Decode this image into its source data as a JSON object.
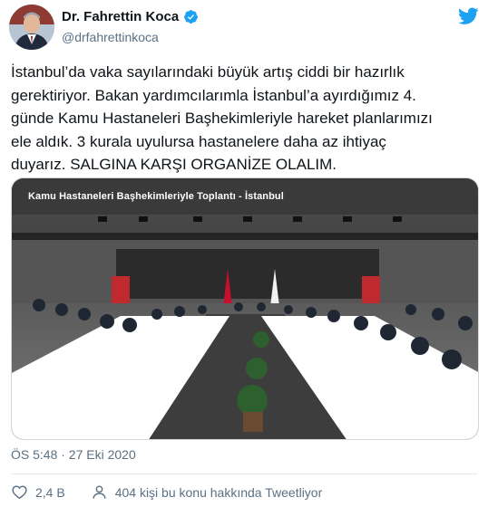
{
  "author": {
    "display_name": "Dr. Fahrettin Koca",
    "handle": "@drfahrettinkoca",
    "verified": true
  },
  "tweet": {
    "text": "İstanbul’da vaka sayılarındaki büyük artış ciddi bir hazırlık\ngerektiriyor. Bakan yardımcılarımla İstanbul’a ayırdığımız 4.\ngünde Kamu Hastaneleri Başhekimleriyle hareket planlarımızı\nele aldık. 3 kurala uyulursa hastanelere daha az ihtiyaç\nduyarız. SALGINA KARŞI ORGANİZE OLALIM.",
    "media_caption": "Kamu Hastaneleri Başhekimleriyle Toplantı - İstanbul",
    "timestamp": "ÖS 5:48 · 27 Eki 2020"
  },
  "actions": {
    "likes": "2,4 B",
    "conversation": "404 kişi bu konu hakkında Tweetliyor"
  },
  "icons": {
    "brand": "twitter-bird-icon",
    "verified": "verified-badge-icon",
    "like": "heart-icon",
    "conversation": "person-icon"
  },
  "colors": {
    "brand": "#1da1f2",
    "secondary_text": "#5b7083",
    "primary_text": "#0f1419"
  }
}
